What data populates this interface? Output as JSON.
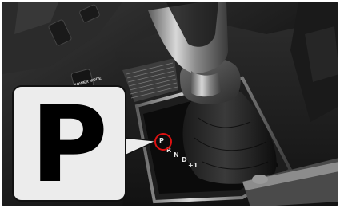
{
  "callout": {
    "letter": "P"
  },
  "shifter": {
    "gears": [
      "P",
      "R",
      "N",
      "D",
      "+1"
    ]
  },
  "buttons": {
    "power_mode_label": "POWER MODE"
  },
  "colors": {
    "marker": "#d11111",
    "callout_bg": "#ececec"
  }
}
